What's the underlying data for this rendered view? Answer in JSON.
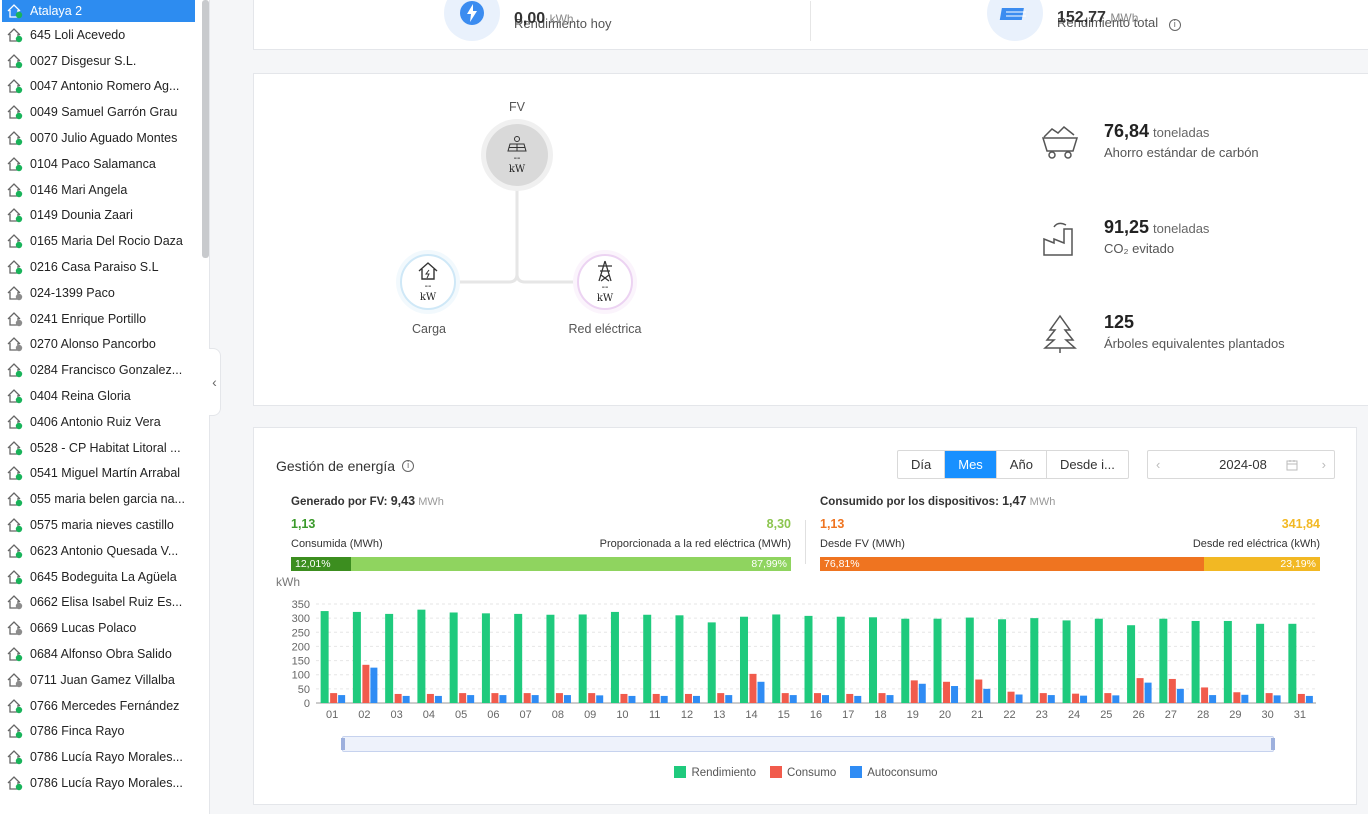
{
  "sidebar": {
    "items": [
      {
        "label": "Atalaya 2",
        "active": true,
        "status": "online"
      },
      {
        "label": " 645 Loli Acevedo",
        "status": "online"
      },
      {
        "label": "0027 Disgesur S.L.",
        "status": "online"
      },
      {
        "label": "0047 Antonio Romero Ag...",
        "status": "online"
      },
      {
        "label": "0049 Samuel Garrón Grau",
        "status": "online"
      },
      {
        "label": "0070 Julio Aguado Montes",
        "status": "online"
      },
      {
        "label": "0104 Paco Salamanca",
        "status": "online"
      },
      {
        "label": "0146 Mari Angela",
        "status": "online"
      },
      {
        "label": "0149 Dounia Zaari",
        "status": "online"
      },
      {
        "label": "0165 Maria Del Rocio Daza",
        "status": "online"
      },
      {
        "label": "0216 Casa Paraiso S.L",
        "status": "online"
      },
      {
        "label": "024-1399 Paco",
        "status": "offline"
      },
      {
        "label": "0241 Enrique Portillo",
        "status": "offline"
      },
      {
        "label": "0270 Alonso Pancorbo",
        "status": "offline"
      },
      {
        "label": "0284 Francisco Gonzalez...",
        "status": "online"
      },
      {
        "label": "0404 Reina Gloria",
        "status": "online"
      },
      {
        "label": "0406 Antonio Ruiz Vera",
        "status": "online"
      },
      {
        "label": "0528 - CP Habitat Litoral ...",
        "status": "online"
      },
      {
        "label": "0541 Miguel Martín Arrabal",
        "status": "online"
      },
      {
        "label": "055 maria belen garcia na...",
        "status": "online"
      },
      {
        "label": "0575 maria nieves castillo",
        "status": "online"
      },
      {
        "label": "0623 Antonio Quesada V...",
        "status": "online"
      },
      {
        "label": "0645 Bodeguita La Agüela",
        "status": "online"
      },
      {
        "label": "0662 Elisa Isabel Ruiz Es...",
        "status": "offline"
      },
      {
        "label": "0669 Lucas Polaco",
        "status": "offline"
      },
      {
        "label": "0684 Alfonso Obra Salido",
        "status": "online"
      },
      {
        "label": "0711 Juan Gamez Villalba",
        "status": "offline"
      },
      {
        "label": "0766 Mercedes Fernández",
        "status": "online"
      },
      {
        "label": "0786 Finca Rayo",
        "status": "online"
      },
      {
        "label": "0786 Lucía Rayo Morales...",
        "status": "online"
      },
      {
        "label": "0786 Lucía Rayo Morales...",
        "status": "online"
      }
    ]
  },
  "top_kpis": {
    "today_value": "0,00",
    "today_unit": "kWh",
    "today_label": "Rendimiento hoy",
    "total_value": "152,77",
    "total_unit": "MWh",
    "total_label": "Rendimiento total"
  },
  "flow": {
    "pv_label": "FV",
    "pv_value": "--",
    "pv_unit": "kW",
    "load_label": "Carga",
    "load_value": "--",
    "load_unit": "kW",
    "grid_label": "Red eléctrica",
    "grid_value": "--",
    "grid_unit": "kW"
  },
  "environment": {
    "coal_value": "76,84",
    "coal_unit": "toneladas",
    "coal_label": "Ahorro estándar de carbón",
    "co2_value": "91,25",
    "co2_unit": "toneladas",
    "co2_label": "CO₂ evitado",
    "trees_value": "125",
    "trees_label": "Árboles equivalentes plantados"
  },
  "energy": {
    "title": "Gestión de energía",
    "tabs": [
      "Día",
      "Mes",
      "Año",
      "Desde i..."
    ],
    "selected_tab": "Mes",
    "date": "2024-08",
    "generated": {
      "label": "Generado por FV:",
      "value": "9,43",
      "unit": "MWh",
      "consumed_value": "1,13",
      "consumed_label": "Consumida (MWh)",
      "fed_value": "8,30",
      "fed_label": "Proporcionada a la red eléctrica (MWh)",
      "pct_self": "12,01%",
      "pct_grid": "87,99%",
      "self_fraction": 0.1201
    },
    "consumed": {
      "label": "Consumido por los dispositivos:",
      "value": "1,47",
      "unit": "MWh",
      "from_pv_value": "1,13",
      "from_pv_label": "Desde FV (MWh)",
      "from_grid_value": "341,84",
      "from_grid_label": "Desde red eléctrica (kWh)",
      "pct_pv": "76,81%",
      "pct_grid": "23,19%",
      "pv_fraction": 0.7681
    }
  },
  "colors": {
    "accent": "#1890ff",
    "rendimiento": "#1fca7d",
    "consumo": "#f15b4c",
    "autoconsumo": "#2f8cf4",
    "gen_dark": "#3c8e1f",
    "gen_light": "#8fd45f",
    "cons_dark": "#ef7420",
    "cons_light": "#f2b823"
  },
  "chart_data": {
    "type": "bar",
    "ylabel": "kWh",
    "ylim": [
      0,
      350
    ],
    "yticks": [
      0,
      50,
      100,
      150,
      200,
      250,
      300,
      350
    ],
    "categories": [
      "01",
      "02",
      "03",
      "04",
      "05",
      "06",
      "07",
      "08",
      "09",
      "10",
      "11",
      "12",
      "13",
      "14",
      "15",
      "16",
      "17",
      "18",
      "19",
      "20",
      "21",
      "22",
      "23",
      "24",
      "25",
      "26",
      "27",
      "28",
      "29",
      "30",
      "31"
    ],
    "series": [
      {
        "name": "Rendimiento",
        "values": [
          325,
          322,
          315,
          330,
          320,
          317,
          315,
          312,
          313,
          322,
          312,
          310,
          285,
          305,
          313,
          308,
          305,
          303,
          298,
          298,
          302,
          296,
          300,
          292,
          298,
          275,
          298,
          290,
          290,
          280,
          280
        ]
      },
      {
        "name": "Consumo",
        "values": [
          35,
          135,
          32,
          32,
          35,
          35,
          35,
          35,
          35,
          32,
          32,
          32,
          35,
          103,
          35,
          35,
          32,
          35,
          80,
          75,
          83,
          40,
          35,
          33,
          35,
          88,
          85,
          55,
          38,
          35,
          32
        ]
      },
      {
        "name": "Autoconsumo",
        "values": [
          28,
          125,
          25,
          25,
          28,
          28,
          28,
          28,
          27,
          25,
          25,
          25,
          28,
          75,
          28,
          28,
          25,
          28,
          68,
          60,
          50,
          30,
          28,
          26,
          27,
          72,
          50,
          28,
          29,
          27,
          25
        ]
      }
    ],
    "grid": true,
    "legend": "bottom"
  }
}
